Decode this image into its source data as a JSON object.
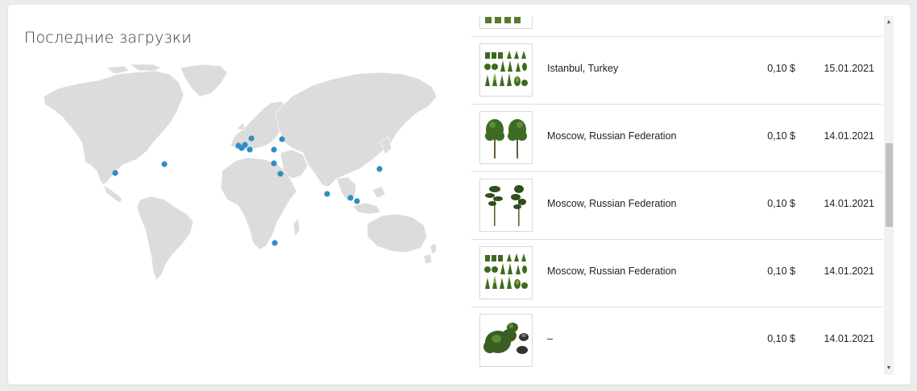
{
  "panel": {
    "title": "Последние загрузки"
  },
  "map": {
    "land_color": "#dcdcdc",
    "marker_color": "#2e8fc4"
  },
  "downloads": [
    {
      "thumb": "trees-green-set-partial",
      "location": "",
      "price": "",
      "date": ""
    },
    {
      "thumb": "plant-collection-icon",
      "location": "Istanbul, Turkey",
      "price": "0,10 $",
      "date": "15.01.2021"
    },
    {
      "thumb": "twin-trees-icon",
      "location": "Moscow, Russian Federation",
      "price": "0,10 $",
      "date": "14.01.2021"
    },
    {
      "thumb": "pine-trees-icon",
      "location": "Moscow, Russian Federation",
      "price": "0,10 $",
      "date": "14.01.2021"
    },
    {
      "thumb": "plant-collection-icon",
      "location": "Moscow, Russian Federation",
      "price": "0,10 $",
      "date": "14.01.2021"
    },
    {
      "thumb": "bushes-icon",
      "location": "–",
      "price": "0,10 $",
      "date": "14.01.2021"
    }
  ],
  "scrollbar": {
    "up_arrow": "▲",
    "down_arrow": "▼"
  }
}
